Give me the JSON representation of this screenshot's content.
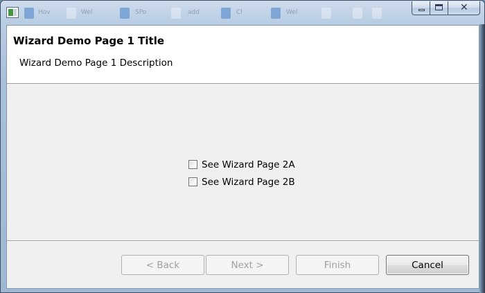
{
  "window": {
    "ghost_titles": [
      "Hov",
      "Wel",
      "SPo",
      "add",
      "Cl",
      "Wel"
    ],
    "caption": {
      "minimize_glyph": "",
      "close_glyph": "✕"
    },
    "app_icon": "wizard-app-icon"
  },
  "wizard": {
    "title": "Wizard Demo Page 1 Title",
    "description": "Wizard Demo Page 1 Description",
    "options": [
      {
        "label": "See Wizard Page 2A",
        "checked": false
      },
      {
        "label": "See Wizard Page 2B",
        "checked": false
      }
    ],
    "buttons": {
      "back": "< Back",
      "next": "Next >",
      "finish": "Finish",
      "cancel": "Cancel"
    }
  },
  "colors": {
    "client_bg": "#f0f0f0",
    "header_bg": "#ffffff",
    "disabled_text": "#a0a0a0"
  }
}
